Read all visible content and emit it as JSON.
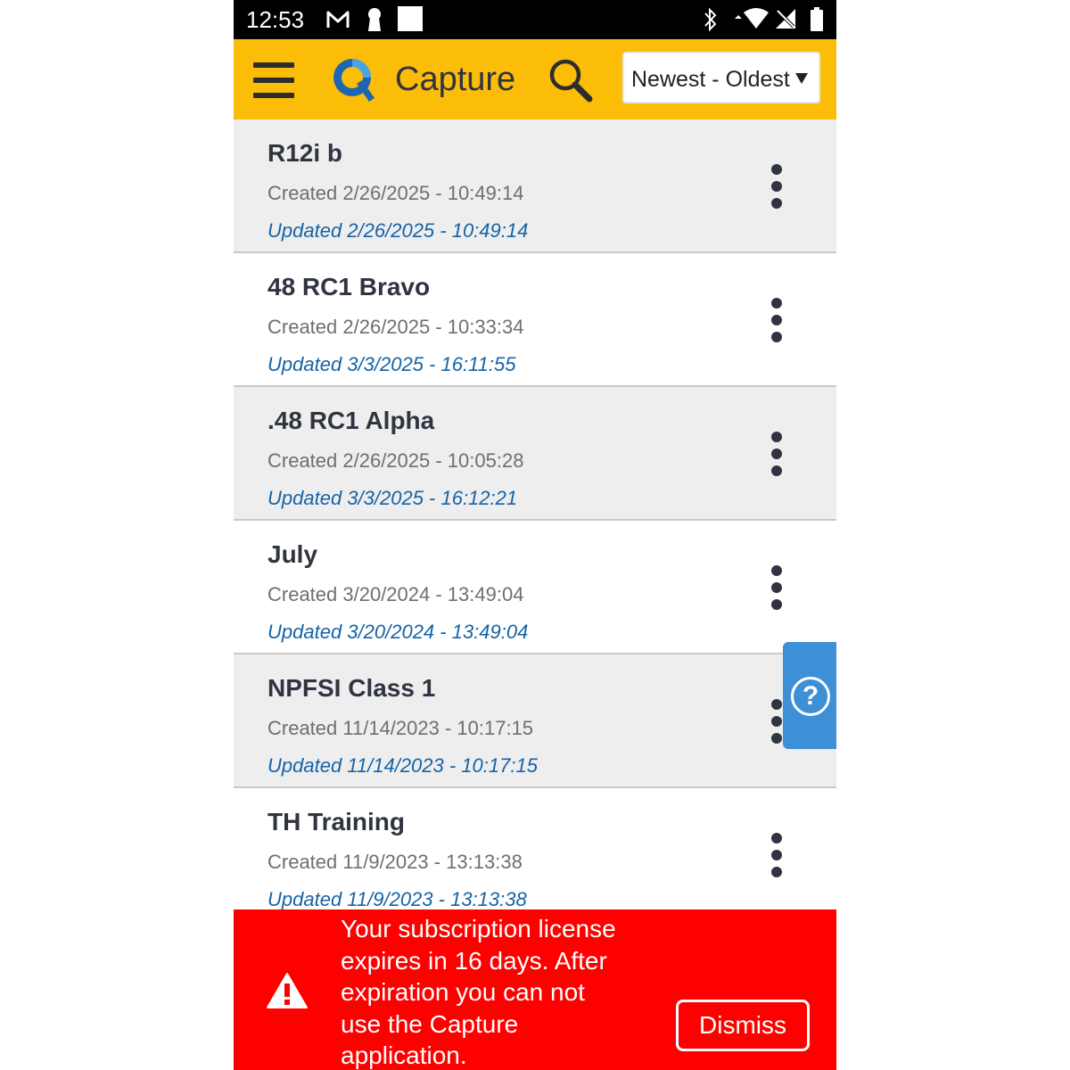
{
  "status_bar": {
    "time": "12:53",
    "left_icons": [
      "gmail-icon",
      "keyhole-icon",
      "square-notification-icon"
    ],
    "right_icons": [
      "bluetooth-icon",
      "wifi-icon",
      "no-signal-icon",
      "battery-icon"
    ]
  },
  "app_bar": {
    "title": "Capture",
    "sort_value": "Newest - Oldest",
    "background_color": "#fbbd08"
  },
  "items": [
    {
      "title": "R12i b",
      "created": "Created 2/26/2025 - 10:49:14",
      "updated": "Updated 2/26/2025 - 10:49:14"
    },
    {
      "title": "48 RC1 Bravo",
      "created": "Created 2/26/2025 - 10:33:34",
      "updated": "Updated 3/3/2025 - 16:11:55"
    },
    {
      "title": ".48 RC1 Alpha",
      "created": "Created 2/26/2025 - 10:05:28",
      "updated": "Updated 3/3/2025 - 16:12:21"
    },
    {
      "title": "July",
      "created": "Created 3/20/2024 - 13:49:04",
      "updated": "Updated 3/20/2024 - 13:49:04"
    },
    {
      "title": "NPFSI Class 1",
      "created": "Created 11/14/2023 - 10:17:15",
      "updated": "Updated 11/14/2023 - 10:17:15"
    },
    {
      "title": "TH Training",
      "created": "Created 11/9/2023 - 13:13:38",
      "updated": "Updated 11/9/2023 - 13:13:38"
    }
  ],
  "help": {
    "symbol": "?",
    "icon": "help-icon",
    "color": "#3d8fd6"
  },
  "banner": {
    "message": "Your subscription license expires in 16 days. After expiration you can not use the Capture application.",
    "dismiss_label": "Dismiss",
    "icon": "warning-icon",
    "background_color": "#fe0000"
  }
}
